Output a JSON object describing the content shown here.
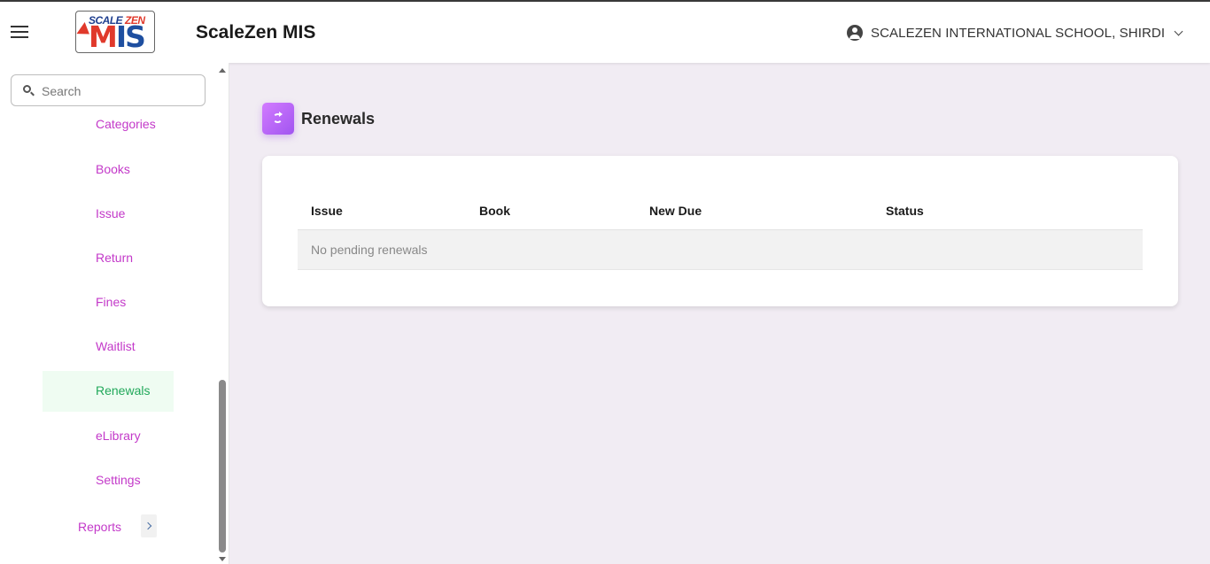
{
  "header": {
    "logo_top_a": "SCALE",
    "logo_top_b": "ZEN",
    "logo_main_a": "M",
    "logo_main_b": "IS",
    "title": "ScaleZen MIS",
    "school_name": "SCALEZEN INTERNATIONAL SCHOOL, SHIRDI",
    "icons": {
      "menu": "hamburger-icon",
      "user": "account-circle-icon",
      "dropdown": "chevron-down-icon"
    }
  },
  "sidebar": {
    "search": {
      "placeholder": "Search",
      "value": ""
    },
    "items": [
      {
        "label": "Categories",
        "active": false
      },
      {
        "label": "Books",
        "active": false
      },
      {
        "label": "Issue",
        "active": false
      },
      {
        "label": "Return",
        "active": false
      },
      {
        "label": "Fines",
        "active": false
      },
      {
        "label": "Waitlist",
        "active": false
      },
      {
        "label": "Renewals",
        "active": true
      },
      {
        "label": "eLibrary",
        "active": false
      },
      {
        "label": "Settings",
        "active": false
      }
    ],
    "reports_label": "Reports"
  },
  "main": {
    "page_title": "Renewals",
    "page_icon": "renew-icon",
    "table": {
      "columns": [
        "Issue",
        "Book",
        "New Due",
        "Status"
      ],
      "empty_message": "No pending renewals"
    }
  },
  "colors": {
    "nav_text": "#c339c9",
    "nav_active_text": "#21a85a",
    "nav_active_bg": "#effcf2",
    "page_bg": "#f1ecf3",
    "accent_icon": "#b965f5"
  }
}
